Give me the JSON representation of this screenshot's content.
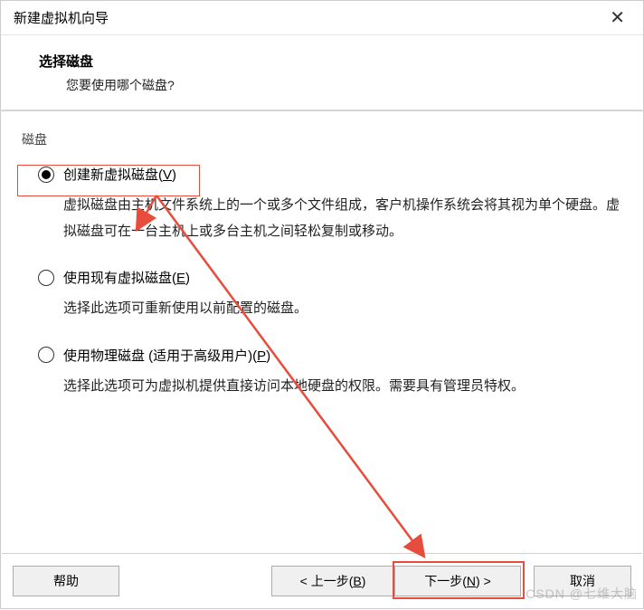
{
  "window": {
    "title": "新建虚拟机向导",
    "close": "✕"
  },
  "header": {
    "title": "选择磁盘",
    "subtitle": "您要使用哪个磁盘?"
  },
  "group_label": "磁盘",
  "options": [
    {
      "label_pre": "创建新虚拟磁盘(",
      "mnemonic": "V",
      "label_post": ")",
      "checked": true,
      "desc": "虚拟磁盘由主机文件系统上的一个或多个文件组成，客户机操作系统会将其视为单个硬盘。虚拟磁盘可在一台主机上或多台主机之间轻松复制或移动。"
    },
    {
      "label_pre": "使用现有虚拟磁盘(",
      "mnemonic": "E",
      "label_post": ")",
      "checked": false,
      "desc": "选择此选项可重新使用以前配置的磁盘。"
    },
    {
      "label_pre": "使用物理磁盘 (适用于高级用户)(",
      "mnemonic": "P",
      "label_post": ")",
      "checked": false,
      "desc": "选择此选项可为虚拟机提供直接访问本地硬盘的权限。需要具有管理员特权。"
    }
  ],
  "buttons": {
    "help": "帮助",
    "back_pre": "< 上一步(",
    "back_mn": "B",
    "back_post": ")",
    "next_pre": "下一步(",
    "next_mn": "N",
    "next_post": ") >",
    "cancel": "取消"
  },
  "watermark": "CSDN @七维大脑"
}
